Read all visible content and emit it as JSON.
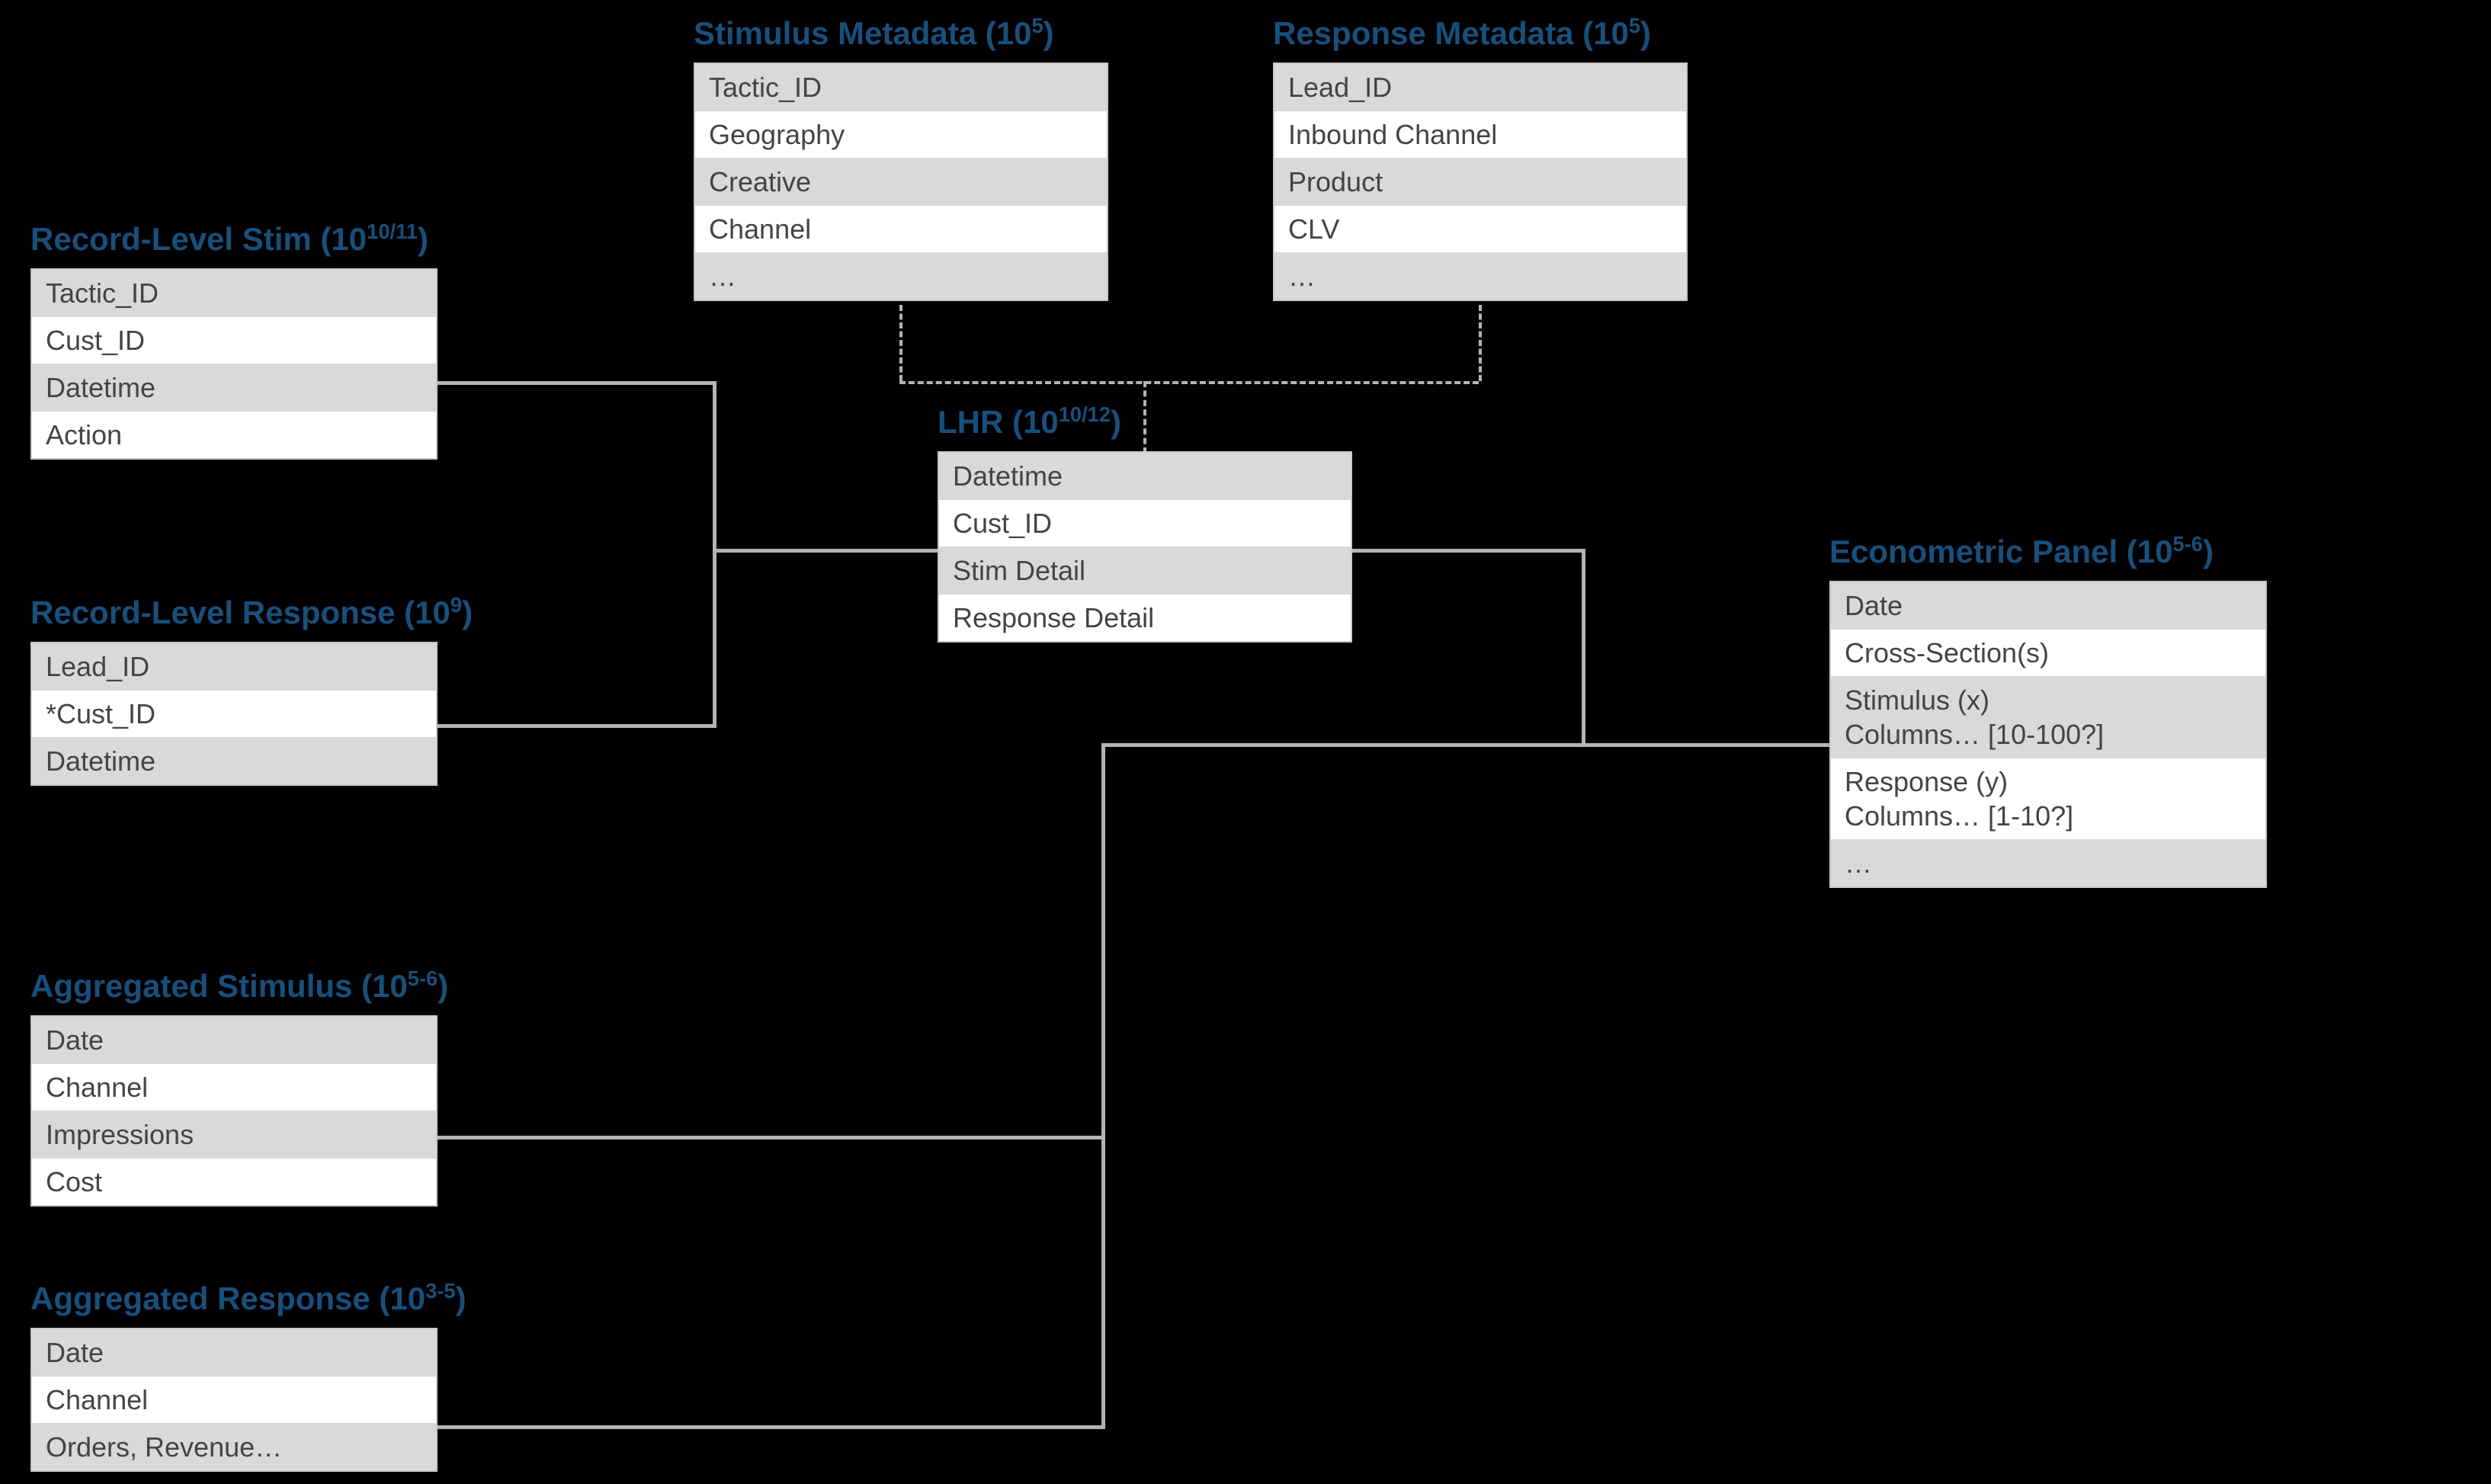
{
  "entities": {
    "recStim": {
      "title": "Record-Level Stim (10<sup>10/11</sup>)",
      "fields": [
        "Tactic_ID",
        "Cust_ID",
        "Datetime",
        "Action"
      ]
    },
    "recResp": {
      "title": "Record-Level Response (10<sup>9</sup>)",
      "fields": [
        "Lead_ID",
        "*Cust_ID",
        "Datetime"
      ]
    },
    "stimMeta": {
      "title": "Stimulus Metadata (10<sup>5</sup>)",
      "fields": [
        "Tactic_ID",
        "Geography",
        "Creative",
        "Channel",
        "…"
      ]
    },
    "respMeta": {
      "title": "Response Metadata (10<sup>5</sup>)",
      "fields": [
        "Lead_ID",
        "Inbound Channel",
        "Product",
        "CLV",
        "…"
      ]
    },
    "lhr": {
      "title": "LHR (10<sup>10/12</sup>)",
      "fields": [
        "Datetime",
        "Cust_ID",
        "Stim Detail",
        "Response Detail"
      ]
    },
    "aggStim": {
      "title": "Aggregated Stimulus (10<sup>5-6</sup>)",
      "fields": [
        "Date",
        "Channel",
        "Impressions",
        "Cost"
      ]
    },
    "aggResp": {
      "title": "Aggregated Response (10<sup>3-5</sup>)",
      "fields": [
        "Date",
        "Channel",
        "Orders, Revenue…"
      ]
    },
    "panel": {
      "title": "Econometric Panel (10<sup>5-6</sup>)",
      "fields": [
        "Date",
        "Cross-Section(s)",
        "Stimulus (x)\nColumns… [10-100?]",
        "Response (y)\nColumns… [1-10?]",
        "…"
      ]
    }
  }
}
